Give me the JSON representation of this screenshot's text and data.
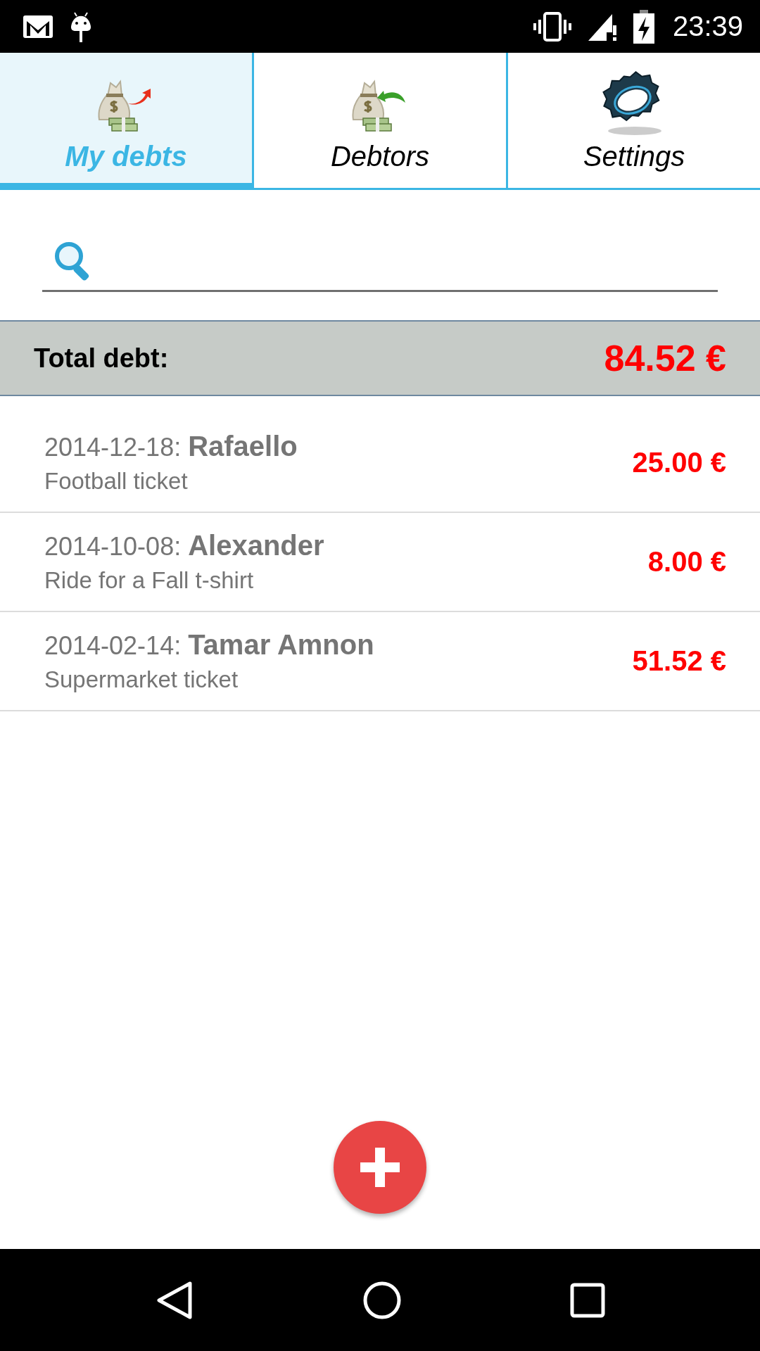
{
  "status_bar": {
    "time": "23:39"
  },
  "tabs": [
    {
      "label": "My debts",
      "selected": true,
      "kind": "debts"
    },
    {
      "label": "Debtors",
      "selected": false,
      "kind": "debtors"
    },
    {
      "label": "Settings",
      "selected": false,
      "kind": "settings"
    }
  ],
  "total": {
    "label": "Total debt:",
    "amount": "84.52 €"
  },
  "debts": [
    {
      "date": "2014-12-18:",
      "name": "Rafaello",
      "description": "Football ticket",
      "amount": "25.00 €"
    },
    {
      "date": "2014-10-08:",
      "name": "Alexander",
      "description": "Ride for a Fall t-shirt",
      "amount": "8.00 €"
    },
    {
      "date": "2014-02-14:",
      "name": "Tamar Amnon",
      "description": "Supermarket ticket",
      "amount": "51.52 €"
    }
  ]
}
